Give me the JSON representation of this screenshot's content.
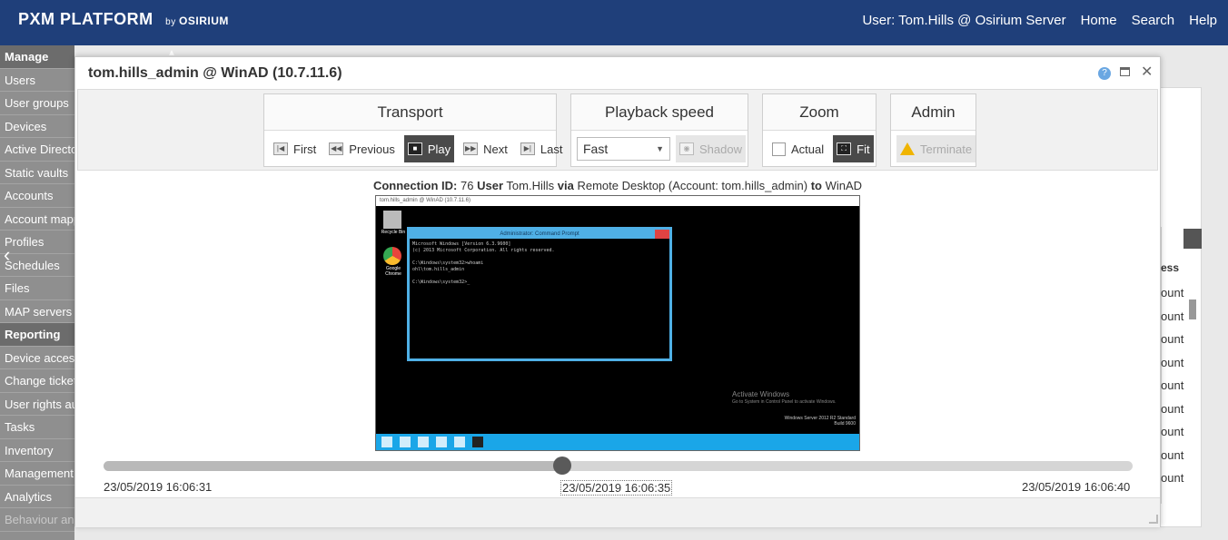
{
  "header": {
    "brand": "PXM PLATFORM",
    "brand_by": "by",
    "brand_company": "OSIRIUM",
    "user": "User: Tom.Hills @ Osirium Server",
    "home": "Home",
    "search": "Search",
    "help": "Help"
  },
  "sidebar": {
    "items": [
      {
        "label": "Manage",
        "section": true
      },
      {
        "label": "Users"
      },
      {
        "label": "User groups"
      },
      {
        "label": "Devices"
      },
      {
        "label": "Active Directory"
      },
      {
        "label": "Static vaults"
      },
      {
        "label": "Accounts"
      },
      {
        "label": "Account mappings"
      },
      {
        "label": "Profiles"
      },
      {
        "label": "Schedules"
      },
      {
        "label": "Files"
      },
      {
        "label": "MAP servers"
      },
      {
        "label": "Reporting",
        "section": true
      },
      {
        "label": "Device access"
      },
      {
        "label": "Change tickets"
      },
      {
        "label": "User rights audit"
      },
      {
        "label": "Tasks"
      },
      {
        "label": "Inventory"
      },
      {
        "label": "Management"
      },
      {
        "label": "Analytics"
      },
      {
        "label": "Behaviour analytics"
      }
    ]
  },
  "background_table": {
    "header": "ess",
    "cells": [
      "ount",
      "ount",
      "ount",
      "ount",
      "ount",
      "ount",
      "ount",
      "ount",
      "ount"
    ]
  },
  "modal": {
    "title": "tom.hills_admin @ WinAD (10.7.11.6)",
    "help_glyph": "?",
    "close_glyph": "✕",
    "transport": {
      "title": "Transport",
      "first": "First",
      "previous": "Previous",
      "play": "Play",
      "next": "Next",
      "last": "Last"
    },
    "playback": {
      "title": "Playback speed",
      "speed": "Fast",
      "shadow": "Shadow"
    },
    "zoom": {
      "title": "Zoom",
      "actual": "Actual",
      "fit": "Fit"
    },
    "admin": {
      "title": "Admin",
      "terminate": "Terminate"
    },
    "connection": {
      "id_label": "Connection ID:",
      "id": "76",
      "user_label": "User",
      "user": "Tom.Hills",
      "via_label": "via",
      "via": "Remote Desktop (Account: tom.hills_admin)",
      "to_label": "to",
      "to": "WinAD"
    },
    "recording": {
      "window_title": "tom.hills_admin @ WinAD (10.7.11.6)",
      "recycle_bin": "Recycle Bin",
      "chrome": "Google Chrome",
      "cmd_title": "Administrator: Command Prompt",
      "cmd_text": "Microsoft Windows [Version 6.3.9600]\n(c) 2013 Microsoft Corporation. All rights reserved.\n\nC:\\Windows\\system32>whoami\nohl\\tom.hills_admin\n\nC:\\Windows\\system32>_",
      "activate_title": "Activate Windows",
      "activate_text": "Go to System in Control Panel to activate Windows.",
      "win_version": "Windows Server 2012 R2 Standard",
      "build": "Build 9600"
    },
    "timeline": {
      "start": "23/05/2019 16:06:31",
      "current": "23/05/2019 16:06:35",
      "end": "23/05/2019 16:06:40",
      "progress": 0.446
    }
  }
}
